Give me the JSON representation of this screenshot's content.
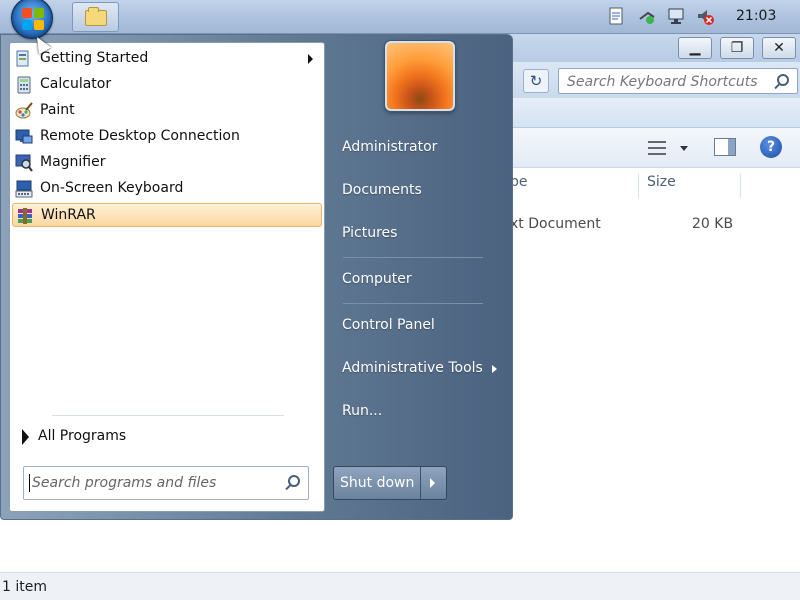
{
  "taskbar": {
    "clock": "21:03",
    "icons": [
      "start-orb-icon",
      "explorer-folder-icon",
      "document-icon",
      "network-icon",
      "monitor-icon",
      "volume-muted-icon"
    ]
  },
  "explorer": {
    "window_buttons": {
      "minimize": "▁",
      "maximize": "❐",
      "close": "✕"
    },
    "refresh_symbol": "↻",
    "search_placeholder": "Search Keyboard Shortcuts",
    "columns": [
      "pe",
      "Size"
    ],
    "rows": [
      {
        "type": "xt Document",
        "size": "20 KB"
      }
    ],
    "help_symbol": "?",
    "status": "1 item"
  },
  "start_menu": {
    "programs": [
      {
        "label": "Getting Started",
        "has_submenu": true,
        "icon": "getting-started-icon"
      },
      {
        "label": "Calculator",
        "has_submenu": false,
        "icon": "calculator-icon"
      },
      {
        "label": "Paint",
        "has_submenu": false,
        "icon": "paint-icon"
      },
      {
        "label": "Remote Desktop Connection",
        "has_submenu": false,
        "icon": "remote-desktop-icon"
      },
      {
        "label": "Magnifier",
        "has_submenu": false,
        "icon": "magnifier-icon"
      },
      {
        "label": "On-Screen Keyboard",
        "has_submenu": false,
        "icon": "keyboard-icon"
      },
      {
        "label": "WinRAR",
        "has_submenu": false,
        "highlighted": true,
        "icon": "winrar-icon"
      }
    ],
    "all_programs": "All Programs",
    "search_placeholder": "Search programs and files",
    "right_items": [
      {
        "label": "Administrator",
        "has_submenu": false
      },
      {
        "label": "Documents",
        "has_submenu": false
      },
      {
        "label": "Pictures",
        "has_submenu": false
      },
      {
        "label": "Computer",
        "has_submenu": false
      },
      {
        "label": "Control Panel",
        "has_submenu": false
      },
      {
        "label": "Administrative Tools",
        "has_submenu": true
      },
      {
        "label": "Run...",
        "has_submenu": false
      }
    ],
    "shutdown": "Shut down"
  },
  "colors": {
    "taskbar": "#aec3df",
    "start_menu_dark": "#4b6280",
    "highlight": "#fbd79e",
    "accent_orange": "#f3761e"
  }
}
